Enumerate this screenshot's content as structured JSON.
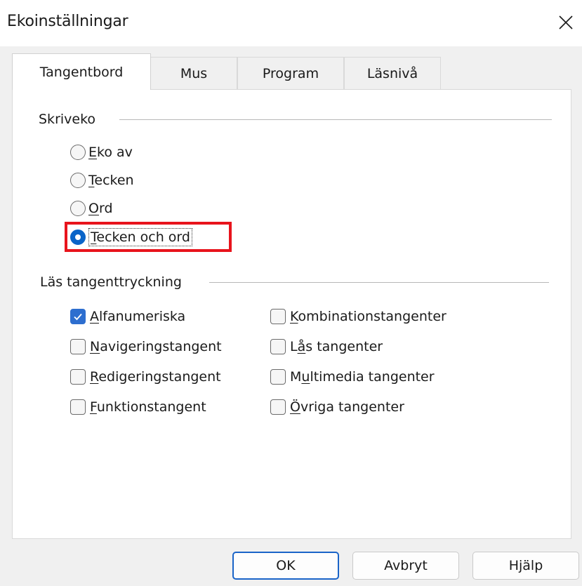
{
  "window": {
    "title": "Ekoinställningar",
    "close_icon": "close-icon"
  },
  "tabs": [
    {
      "label": "Tangentbord",
      "active": true
    },
    {
      "label": "Mus",
      "active": false
    },
    {
      "label": "Program",
      "active": false
    },
    {
      "label": "Läsnivå",
      "active": false
    }
  ],
  "typing_echo": {
    "heading": "Skriveko",
    "options": [
      {
        "access_key": "E",
        "rest": "ko av",
        "checked": false
      },
      {
        "access_key": "T",
        "rest": "ecken",
        "checked": false
      },
      {
        "access_key": "O",
        "rest": "rd",
        "checked": false
      },
      {
        "access_key": "T",
        "rest": "ecken och ord",
        "checked": true
      }
    ]
  },
  "read_keys": {
    "heading": "Läs tangenttryckning",
    "left": [
      {
        "access_key": "A",
        "rest": "lfanumeriska",
        "checked": true
      },
      {
        "access_key": "N",
        "rest": "avigeringstangent",
        "checked": false
      },
      {
        "access_key": "R",
        "rest": "edigeringstangent",
        "checked": false
      },
      {
        "access_key": "F",
        "rest": "unktionstangent",
        "checked": false
      }
    ],
    "right": [
      {
        "before": "",
        "access_key": "K",
        "rest": "ombinationstangenter",
        "checked": false
      },
      {
        "before": "L",
        "access_key": "å",
        "rest": "s tangenter",
        "checked": false
      },
      {
        "before": "M",
        "access_key": "u",
        "rest": "ltimedia tangenter",
        "checked": false
      },
      {
        "before": "",
        "access_key": "Ö",
        "rest": "vriga tangenter",
        "checked": false
      }
    ]
  },
  "buttons": {
    "ok": "OK",
    "cancel": "Avbryt",
    "help": "Hjälp"
  },
  "colors": {
    "accent": "#0a64c8",
    "highlight": "#e8141c"
  }
}
